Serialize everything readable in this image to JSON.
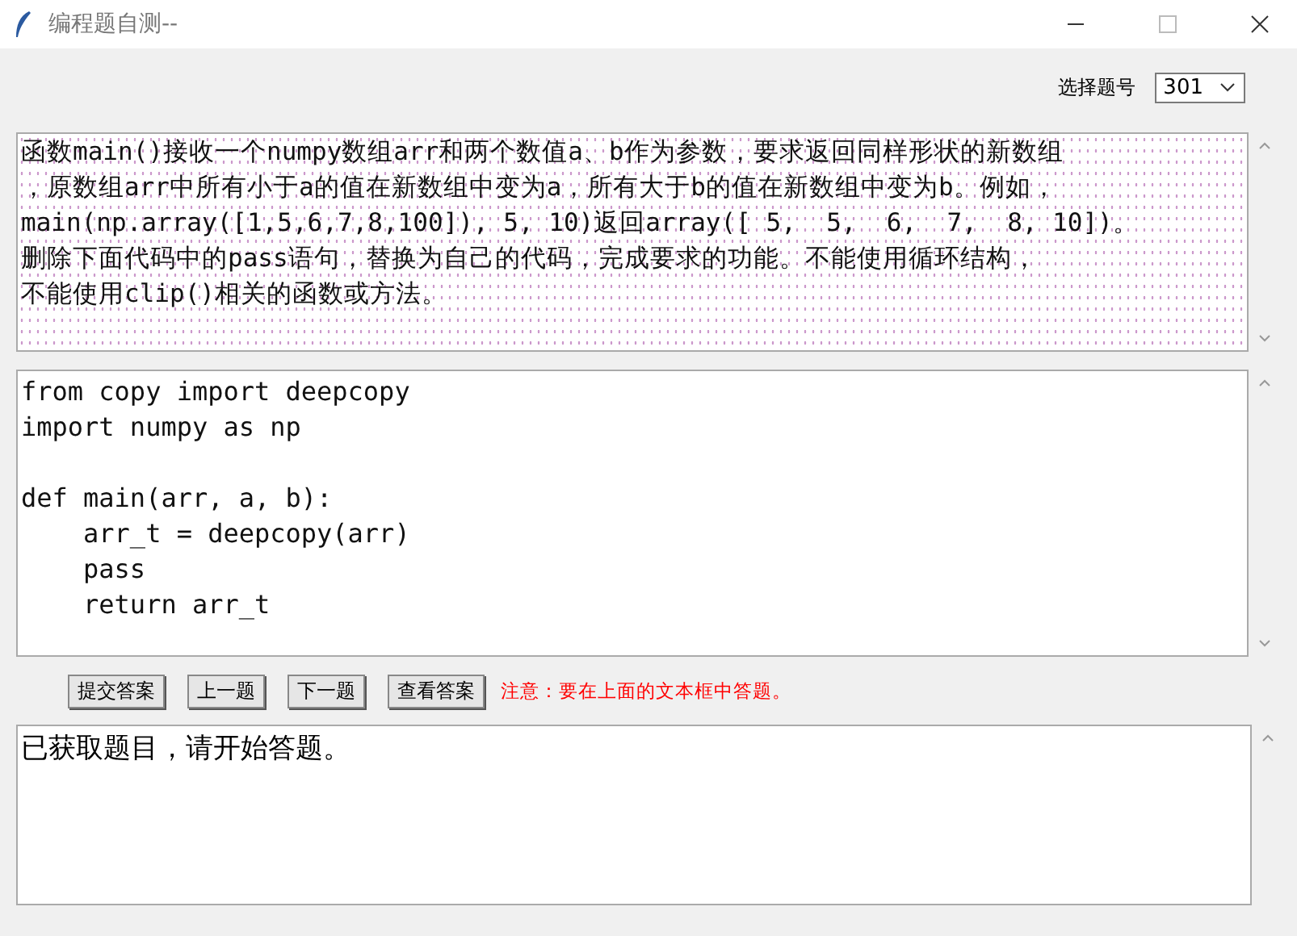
{
  "window": {
    "title": "编程题自测--"
  },
  "question_select": {
    "label": "选择题号",
    "value": "301"
  },
  "question": {
    "lines": [
      "函数main()接收一个numpy数组arr和两个数值a、b作为参数，要求返回同样形状的新数组",
      "，原数组arr中所有小于a的值在新数组中变为a，所有大于b的值在新数组中变为b。例如，",
      "main(np.array([1,5,6,7,8,100]), 5, 10)返回array([ 5,  5,  6,  7,  8, 10])。",
      "删除下面代码中的pass语句，替换为自己的代码，完成要求的功能。不能使用循环结构，",
      "不能使用clip()相关的函数或方法。"
    ]
  },
  "code": "from copy import deepcopy\nimport numpy as np\n\ndef main(arr, a, b):\n    arr_t = deepcopy(arr)\n    pass\n    return arr_t",
  "buttons": [
    "提交答案",
    "上一题",
    "下一题",
    "查看答案"
  ],
  "notice": "注意：要在上面的文本框中答题。",
  "output": "已获取题目，请开始答题。"
}
